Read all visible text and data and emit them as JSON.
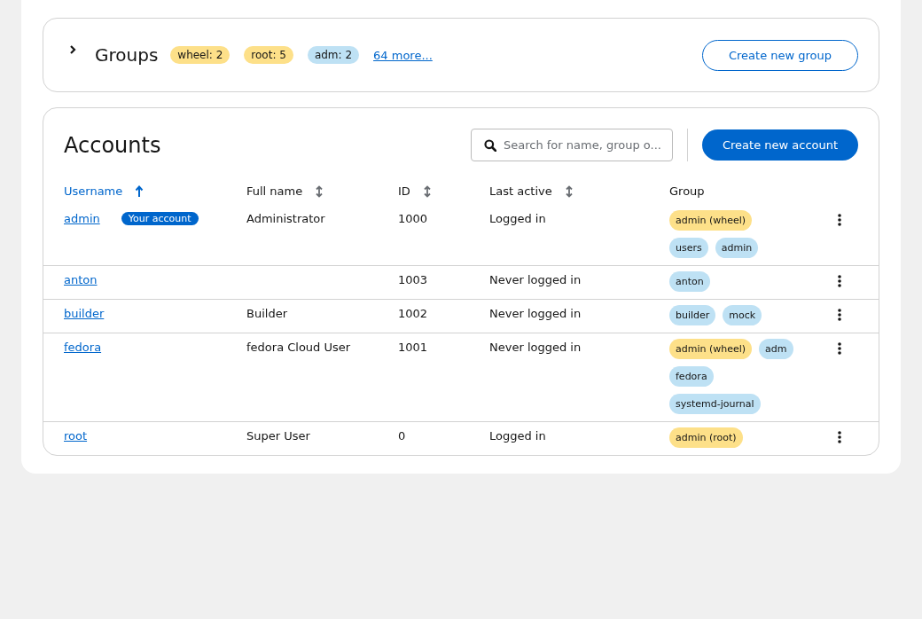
{
  "groups": {
    "title": "Groups",
    "expanded": false,
    "labels": [
      {
        "text": "wheel: 2",
        "color": "#fde089"
      },
      {
        "text": "root: 5",
        "color": "#fde089"
      },
      {
        "text": "adm: 2",
        "color": "#bee1f4"
      }
    ],
    "more": "64 more...",
    "button": "Create new group"
  },
  "accounts": {
    "title": "Accounts",
    "search": {
      "placeholder": "Search for name, group o..."
    },
    "button": "Create new account",
    "columns": [
      {
        "label": "Username",
        "sorted": true
      },
      {
        "label": "Full name",
        "sorted": false
      },
      {
        "label": "ID",
        "sorted": false
      },
      {
        "label": "Last active",
        "sorted": false
      },
      {
        "label": "Group"
      }
    ],
    "rows": [
      {
        "username": "admin",
        "badge": "Your account",
        "full_name": "Administrator",
        "id": "1000",
        "last_active": "Logged in",
        "groups": [
          {
            "text": "admin (wheel)",
            "color": "#fde089"
          },
          {
            "text": "users",
            "color": "#bee1f4"
          },
          {
            "text": "admin",
            "color": "#bee1f4"
          }
        ]
      },
      {
        "username": "anton",
        "full_name": "",
        "id": "1003",
        "last_active": "Never logged in",
        "groups": [
          {
            "text": "anton",
            "color": "#bee1f4"
          }
        ]
      },
      {
        "username": "builder",
        "full_name": "Builder",
        "id": "1002",
        "last_active": "Never logged in",
        "groups": [
          {
            "text": "builder",
            "color": "#bee1f4"
          },
          {
            "text": "mock",
            "color": "#bee1f4"
          }
        ]
      },
      {
        "username": "fedora",
        "full_name": "fedora Cloud User",
        "id": "1001",
        "last_active": "Never logged in",
        "groups": [
          {
            "text": "admin (wheel)",
            "color": "#fde089"
          },
          {
            "text": "adm",
            "color": "#bee1f4"
          },
          {
            "text": "fedora",
            "color": "#bee1f4"
          },
          {
            "text": "systemd-journal",
            "color": "#bee1f4"
          }
        ]
      },
      {
        "username": "root",
        "full_name": "Super User",
        "id": "0",
        "last_active": "Logged in",
        "groups": [
          {
            "text": "admin (root)",
            "color": "#fde089"
          }
        ]
      }
    ]
  }
}
